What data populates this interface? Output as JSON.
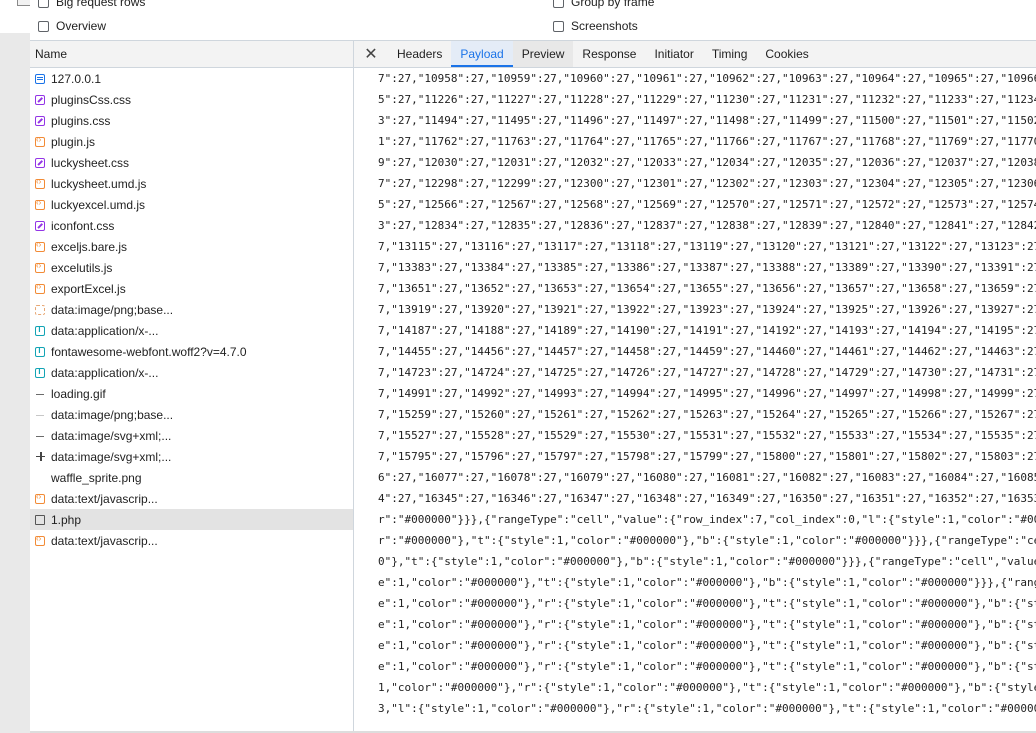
{
  "filters": {
    "big_request_rows": "Big request rows",
    "group_by_frame": "Group by frame",
    "overview": "Overview",
    "screenshots": "Screenshots"
  },
  "requests": {
    "header": "Name",
    "items": [
      {
        "name": "127.0.0.1",
        "icon": "document-icon"
      },
      {
        "name": "pluginsCss.css",
        "icon": "stylesheet-icon"
      },
      {
        "name": "plugins.css",
        "icon": "stylesheet-icon"
      },
      {
        "name": "plugin.js",
        "icon": "script-icon"
      },
      {
        "name": "luckysheet.css",
        "icon": "stylesheet-icon"
      },
      {
        "name": "luckysheet.umd.js",
        "icon": "script-icon"
      },
      {
        "name": "luckyexcel.umd.js",
        "icon": "script-icon"
      },
      {
        "name": "iconfont.css",
        "icon": "stylesheet-icon"
      },
      {
        "name": "exceljs.bare.js",
        "icon": "script-icon"
      },
      {
        "name": "excelutils.js",
        "icon": "script-icon"
      },
      {
        "name": "exportExcel.js",
        "icon": "script-icon"
      },
      {
        "name": "data:image/png;base...",
        "icon": "image-icon"
      },
      {
        "name": "data:application/x-...",
        "icon": "font-icon"
      },
      {
        "name": "fontawesome-webfont.woff2?v=4.7.0",
        "icon": "font-icon"
      },
      {
        "name": "data:application/x-...",
        "icon": "font-icon"
      },
      {
        "name": "loading.gif",
        "icon": "dash-icon"
      },
      {
        "name": "data:image/png;base...",
        "icon": "dash-light-icon"
      },
      {
        "name": "data:image/svg+xml;...",
        "icon": "dash-icon"
      },
      {
        "name": "data:image/svg+xml;...",
        "icon": "plus-icon"
      },
      {
        "name": "waffle_sprite.png",
        "icon": "blank-icon"
      },
      {
        "name": "data:text/javascrip...",
        "icon": "script-icon"
      },
      {
        "name": "1.php",
        "icon": "page-icon",
        "selected": true
      },
      {
        "name": "data:text/javascrip...",
        "icon": "script-icon"
      }
    ]
  },
  "detail_tabs": {
    "close": "✕",
    "tabs": [
      "Headers",
      "Payload",
      "Preview",
      "Response",
      "Initiator",
      "Timing",
      "Cookies"
    ],
    "active": "Payload"
  },
  "payload_lines": [
    "7\":27,\"10958\":27,\"10959\":27,\"10960\":27,\"10961\":27,\"10962\":27,\"10963\":27,\"10964\":27,\"10965\":27,\"10966",
    "5\":27,\"11226\":27,\"11227\":27,\"11228\":27,\"11229\":27,\"11230\":27,\"11231\":27,\"11232\":27,\"11233\":27,\"11234",
    "3\":27,\"11494\":27,\"11495\":27,\"11496\":27,\"11497\":27,\"11498\":27,\"11499\":27,\"11500\":27,\"11501\":27,\"11502",
    "1\":27,\"11762\":27,\"11763\":27,\"11764\":27,\"11765\":27,\"11766\":27,\"11767\":27,\"11768\":27,\"11769\":27,\"11770",
    "9\":27,\"12030\":27,\"12031\":27,\"12032\":27,\"12033\":27,\"12034\":27,\"12035\":27,\"12036\":27,\"12037\":27,\"12038",
    "7\":27,\"12298\":27,\"12299\":27,\"12300\":27,\"12301\":27,\"12302\":27,\"12303\":27,\"12304\":27,\"12305\":27,\"12306",
    "5\":27,\"12566\":27,\"12567\":27,\"12568\":27,\"12569\":27,\"12570\":27,\"12571\":27,\"12572\":27,\"12573\":27,\"12574",
    "3\":27,\"12834\":27,\"12835\":27,\"12836\":27,\"12837\":27,\"12838\":27,\"12839\":27,\"12840\":27,\"12841\":27,\"12842",
    "7,\"13115\":27,\"13116\":27,\"13117\":27,\"13118\":27,\"13119\":27,\"13120\":27,\"13121\":27,\"13122\":27,\"13123\":27",
    "7,\"13383\":27,\"13384\":27,\"13385\":27,\"13386\":27,\"13387\":27,\"13388\":27,\"13389\":27,\"13390\":27,\"13391\":27",
    "7,\"13651\":27,\"13652\":27,\"13653\":27,\"13654\":27,\"13655\":27,\"13656\":27,\"13657\":27,\"13658\":27,\"13659\":27",
    "7,\"13919\":27,\"13920\":27,\"13921\":27,\"13922\":27,\"13923\":27,\"13924\":27,\"13925\":27,\"13926\":27,\"13927\":27",
    "7,\"14187\":27,\"14188\":27,\"14189\":27,\"14190\":27,\"14191\":27,\"14192\":27,\"14193\":27,\"14194\":27,\"14195\":27",
    "7,\"14455\":27,\"14456\":27,\"14457\":27,\"14458\":27,\"14459\":27,\"14460\":27,\"14461\":27,\"14462\":27,\"14463\":27",
    "7,\"14723\":27,\"14724\":27,\"14725\":27,\"14726\":27,\"14727\":27,\"14728\":27,\"14729\":27,\"14730\":27,\"14731\":27",
    "7,\"14991\":27,\"14992\":27,\"14993\":27,\"14994\":27,\"14995\":27,\"14996\":27,\"14997\":27,\"14998\":27,\"14999\":27",
    "7,\"15259\":27,\"15260\":27,\"15261\":27,\"15262\":27,\"15263\":27,\"15264\":27,\"15265\":27,\"15266\":27,\"15267\":27",
    "7,\"15527\":27,\"15528\":27,\"15529\":27,\"15530\":27,\"15531\":27,\"15532\":27,\"15533\":27,\"15534\":27,\"15535\":27",
    "7,\"15795\":27,\"15796\":27,\"15797\":27,\"15798\":27,\"15799\":27,\"15800\":27,\"15801\":27,\"15802\":27,\"15803\":27",
    "6\":27,\"16077\":27,\"16078\":27,\"16079\":27,\"16080\":27,\"16081\":27,\"16082\":27,\"16083\":27,\"16084\":27,\"16085",
    "4\":27,\"16345\":27,\"16346\":27,\"16347\":27,\"16348\":27,\"16349\":27,\"16350\":27,\"16351\":27,\"16352\":27,\"16353",
    "r\":\"#000000\"}}},{\"rangeType\":\"cell\",\"value\":{\"row_index\":7,\"col_index\":0,\"l\":{\"style\":1,\"color\":\"#00",
    "r\":\"#000000\"},\"t\":{\"style\":1,\"color\":\"#000000\"},\"b\":{\"style\":1,\"color\":\"#000000\"}}},{\"rangeType\":\"ce",
    "0\"},\"t\":{\"style\":1,\"color\":\"#000000\"},\"b\":{\"style\":1,\"color\":\"#000000\"}}},{\"rangeType\":\"cell\",\"value",
    "e\":1,\"color\":\"#000000\"},\"t\":{\"style\":1,\"color\":\"#000000\"},\"b\":{\"style\":1,\"color\":\"#000000\"}}},{\"rang",
    "e\":1,\"color\":\"#000000\"},\"r\":{\"style\":1,\"color\":\"#000000\"},\"t\":{\"style\":1,\"color\":\"#000000\"},\"b\":{\"st",
    "e\":1,\"color\":\"#000000\"},\"r\":{\"style\":1,\"color\":\"#000000\"},\"t\":{\"style\":1,\"color\":\"#000000\"},\"b\":{\"st",
    "e\":1,\"color\":\"#000000\"},\"r\":{\"style\":1,\"color\":\"#000000\"},\"t\":{\"style\":1,\"color\":\"#000000\"},\"b\":{\"st",
    "e\":1,\"color\":\"#000000\"},\"r\":{\"style\":1,\"color\":\"#000000\"},\"t\":{\"style\":1,\"color\":\"#000000\"},\"b\":{\"st",
    "1,\"color\":\"#000000\"},\"r\":{\"style\":1,\"color\":\"#000000\"},\"t\":{\"style\":1,\"color\":\"#000000\"},\"b\":{\"style",
    "3,\"l\":{\"style\":1,\"color\":\"#000000\"},\"r\":{\"style\":1,\"color\":\"#000000\"},\"t\":{\"style\":1,\"color\":\"#000000"
  ],
  "colors": {
    "accent": "#1a73e8",
    "selected_row": "#e3e3e3",
    "panel_header": "#f3f3f3",
    "border": "#cfd6dd"
  }
}
